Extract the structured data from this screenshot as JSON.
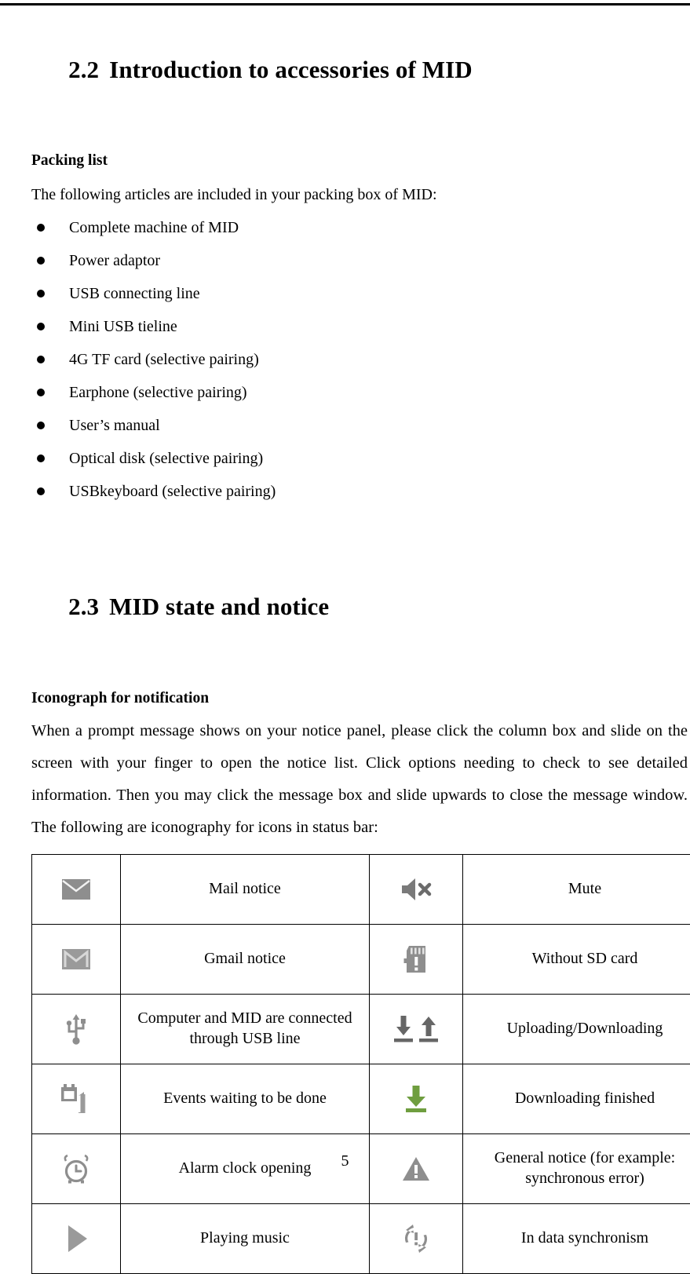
{
  "document": {
    "page_number": "5"
  },
  "sections": {
    "s22": {
      "number": "2.2",
      "title": "Introduction to accessories of MID",
      "sub_heading": "Packing list",
      "intro": "The following articles are included in your packing box of MID:",
      "packing_list": [
        "Complete machine of MID",
        "Power adaptor",
        "USB connecting line",
        "Mini USB tieline",
        "4G TF card (selective pairing)",
        "Earphone (selective pairing)",
        "User’s manual",
        "Optical disk (selective pairing)",
        "USBkeyboard (selective pairing)"
      ]
    },
    "s23": {
      "number": "2.3",
      "title": "MID state and notice",
      "sub_heading": "Iconograph for notification",
      "paragraph": "When a prompt message shows on your notice panel, please click the column box and slide on the screen with your finger to open the notice list. Click options needing to check to see detailed information. Then you may click the message box and slide upwards to close the message window. The following are iconography for icons in status bar:"
    }
  },
  "icon_table": {
    "rows": [
      {
        "left_icon": "mail-envelope-icon",
        "left_label": "Mail notice",
        "right_icon": "speaker-mute-icon",
        "right_label": "Mute"
      },
      {
        "left_icon": "gmail-envelope-icon",
        "left_label": "Gmail notice",
        "right_icon": "sd-card-missing-icon",
        "right_label": "Without SD card"
      },
      {
        "left_icon": "usb-icon",
        "left_label": "Computer and MID are connected through USB line",
        "right_icon": "upload-download-arrows-icon",
        "right_label": "Uploading/Downloading"
      },
      {
        "left_icon": "calendar-event-icon",
        "left_label": "Events waiting to be done",
        "right_icon": "download-complete-icon",
        "right_label": "Downloading finished"
      },
      {
        "left_icon": "alarm-clock-icon",
        "left_label": "Alarm clock opening",
        "right_icon": "warning-triangle-icon",
        "right_label": "General notice (for example: synchronous error)"
      },
      {
        "left_icon": "play-music-icon",
        "left_label": "Playing music",
        "right_icon": "data-sync-icon",
        "right_label": "In data synchronism"
      }
    ]
  },
  "colors": {
    "icon_gray": "#8e8e8e",
    "icon_dark_gray": "#666666",
    "icon_green": "#6f9e3f",
    "rule": "#000000",
    "text": "#000000"
  }
}
